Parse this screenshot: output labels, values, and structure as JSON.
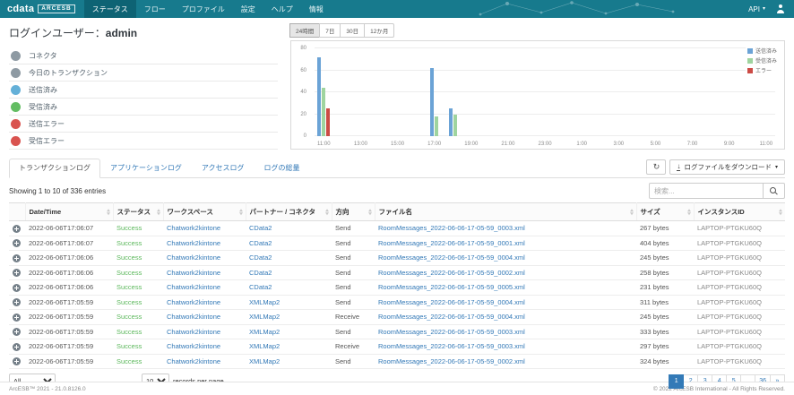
{
  "navbar": {
    "brand": {
      "name": "cdata",
      "product": "ARCESB"
    },
    "items": [
      {
        "label": "ステータス",
        "active": true
      },
      {
        "label": "フロー"
      },
      {
        "label": "プロファイル"
      },
      {
        "label": "設定"
      },
      {
        "label": "ヘルプ"
      },
      {
        "label": "情報"
      }
    ],
    "api_label": "API"
  },
  "icons": {
    "caret": "▾",
    "refresh": "↻",
    "download": "↓"
  },
  "status_panel": {
    "title": "ログインユーザー：",
    "username": "admin",
    "metrics": [
      {
        "label": "コネクタ",
        "color": "#8e9aa3"
      },
      {
        "label": "今日のトランザクション",
        "color": "#8e9aa3"
      },
      {
        "label": "送信済み",
        "color": "#64b0d8"
      },
      {
        "label": "受信済み",
        "color": "#63bd63"
      },
      {
        "label": "送信エラー",
        "color": "#d9534f"
      },
      {
        "label": "受信エラー",
        "color": "#d9534f"
      }
    ]
  },
  "chart": {
    "range_buttons": [
      {
        "label": "24時間",
        "active": true
      },
      {
        "label": "7日"
      },
      {
        "label": "30日"
      },
      {
        "label": "12か月"
      }
    ],
    "chart_data": {
      "type": "bar",
      "title": "",
      "xlabel": "",
      "ylabel": "",
      "categories": [
        "11:00",
        "12:00",
        "13:00",
        "14:00",
        "15:00",
        "16:00",
        "17:00",
        "18:00",
        "19:00",
        "20:00",
        "21:00",
        "22:00",
        "23:00",
        "0:00",
        "1:00",
        "2:00",
        "3:00",
        "4:00",
        "5:00",
        "6:00",
        "7:00",
        "8:00",
        "9:00",
        "10:00",
        "11:00"
      ],
      "x_label_every": 2,
      "series": [
        {
          "name": "送信済み",
          "color": "#6ba3d6",
          "values": [
            72,
            0,
            0,
            0,
            0,
            0,
            62,
            25,
            0,
            0,
            0,
            0,
            0,
            0,
            0,
            0,
            0,
            0,
            0,
            0,
            0,
            0,
            0,
            0,
            0
          ]
        },
        {
          "name": "受信済み",
          "color": "#9fd49f",
          "values": [
            44,
            0,
            0,
            0,
            0,
            0,
            18,
            20,
            0,
            0,
            0,
            0,
            0,
            0,
            0,
            0,
            0,
            0,
            0,
            0,
            0,
            0,
            0,
            0,
            0
          ]
        },
        {
          "name": "エラー",
          "color": "#cc4b45",
          "values": [
            25,
            0,
            0,
            0,
            0,
            0,
            0,
            0,
            0,
            0,
            0,
            0,
            0,
            0,
            0,
            0,
            0,
            0,
            0,
            0,
            0,
            0,
            0,
            0,
            0
          ]
        }
      ],
      "ylim": [
        0,
        80
      ],
      "yticks": [
        0,
        20,
        40,
        60,
        80
      ],
      "grid": true,
      "legend_position": "right-top"
    }
  },
  "log_tabs": [
    {
      "label": "トランザクションログ",
      "active": true
    },
    {
      "label": "アプリケーションログ"
    },
    {
      "label": "アクセスログ"
    },
    {
      "label": "ログの総量"
    }
  ],
  "toolbar": {
    "download_label": "ログファイルをダウンロード"
  },
  "table": {
    "showing": "Showing 1 to 10 of 336 entries",
    "search_placeholder": "検索...",
    "columns": [
      {
        "label": "",
        "no_sort": true
      },
      {
        "label": "Date/Time"
      },
      {
        "label": "ステータス"
      },
      {
        "label": "ワークスペース"
      },
      {
        "label": "パートナー / コネクタ"
      },
      {
        "label": "方向"
      },
      {
        "label": "ファイル名"
      },
      {
        "label": "サイズ"
      },
      {
        "label": "インスタンスID"
      }
    ],
    "rows": [
      {
        "time": "2022-06-06T17:06:07",
        "status": "Success",
        "workspace": "Chatwork2kintone",
        "partner": "CData2",
        "direction": "Send",
        "file": "RoomMessages_2022-06-06-17-05-59_0003.xml",
        "size": "267 bytes",
        "instance": "LAPTOP-PTGKU60Q"
      },
      {
        "time": "2022-06-06T17:06:07",
        "status": "Success",
        "workspace": "Chatwork2kintone",
        "partner": "CData2",
        "direction": "Send",
        "file": "RoomMessages_2022-06-06-17-05-59_0001.xml",
        "size": "404 bytes",
        "instance": "LAPTOP-PTGKU60Q"
      },
      {
        "time": "2022-06-06T17:06:06",
        "status": "Success",
        "workspace": "Chatwork2kintone",
        "partner": "CData2",
        "direction": "Send",
        "file": "RoomMessages_2022-06-06-17-05-59_0004.xml",
        "size": "245 bytes",
        "instance": "LAPTOP-PTGKU60Q"
      },
      {
        "time": "2022-06-06T17:06:06",
        "status": "Success",
        "workspace": "Chatwork2kintone",
        "partner": "CData2",
        "direction": "Send",
        "file": "RoomMessages_2022-06-06-17-05-59_0002.xml",
        "size": "258 bytes",
        "instance": "LAPTOP-PTGKU60Q"
      },
      {
        "time": "2022-06-06T17:06:06",
        "status": "Success",
        "workspace": "Chatwork2kintone",
        "partner": "CData2",
        "direction": "Send",
        "file": "RoomMessages_2022-06-06-17-05-59_0005.xml",
        "size": "231 bytes",
        "instance": "LAPTOP-PTGKU60Q"
      },
      {
        "time": "2022-06-06T17:05:59",
        "status": "Success",
        "workspace": "Chatwork2kintone",
        "partner": "XMLMap2",
        "direction": "Send",
        "file": "RoomMessages_2022-06-06-17-05-59_0004.xml",
        "size": "311 bytes",
        "instance": "LAPTOP-PTGKU60Q"
      },
      {
        "time": "2022-06-06T17:05:59",
        "status": "Success",
        "workspace": "Chatwork2kintone",
        "partner": "XMLMap2",
        "direction": "Receive",
        "file": "RoomMessages_2022-06-06-17-05-59_0004.xml",
        "size": "245 bytes",
        "instance": "LAPTOP-PTGKU60Q"
      },
      {
        "time": "2022-06-06T17:05:59",
        "status": "Success",
        "workspace": "Chatwork2kintone",
        "partner": "XMLMap2",
        "direction": "Send",
        "file": "RoomMessages_2022-06-06-17-05-59_0003.xml",
        "size": "333 bytes",
        "instance": "LAPTOP-PTGKU60Q"
      },
      {
        "time": "2022-06-06T17:05:59",
        "status": "Success",
        "workspace": "Chatwork2kintone",
        "partner": "XMLMap2",
        "direction": "Receive",
        "file": "RoomMessages_2022-06-06-17-05-59_0003.xml",
        "size": "297 bytes",
        "instance": "LAPTOP-PTGKU60Q"
      },
      {
        "time": "2022-06-06T17:05:59",
        "status": "Success",
        "workspace": "Chatwork2kintone",
        "partner": "XMLMap2",
        "direction": "Send",
        "file": "RoomMessages_2022-06-06-17-05-59_0002.xml",
        "size": "324 bytes",
        "instance": "LAPTOP-PTGKU60Q"
      }
    ]
  },
  "table_footer": {
    "filter_value": "All",
    "page_size": "10",
    "records_label": "records per page",
    "pages": [
      {
        "label": "1",
        "active": true
      },
      {
        "label": "2"
      },
      {
        "label": "3"
      },
      {
        "label": "4"
      },
      {
        "label": "5"
      },
      {
        "label": "…",
        "ellipsis": true
      },
      {
        "label": "36"
      },
      {
        "label": "»"
      }
    ]
  },
  "footer": {
    "left": "ArcESB™ 2021 - 21.0.8126.0",
    "right": "© 2022 ArcESB International - All Rights Reserved."
  }
}
